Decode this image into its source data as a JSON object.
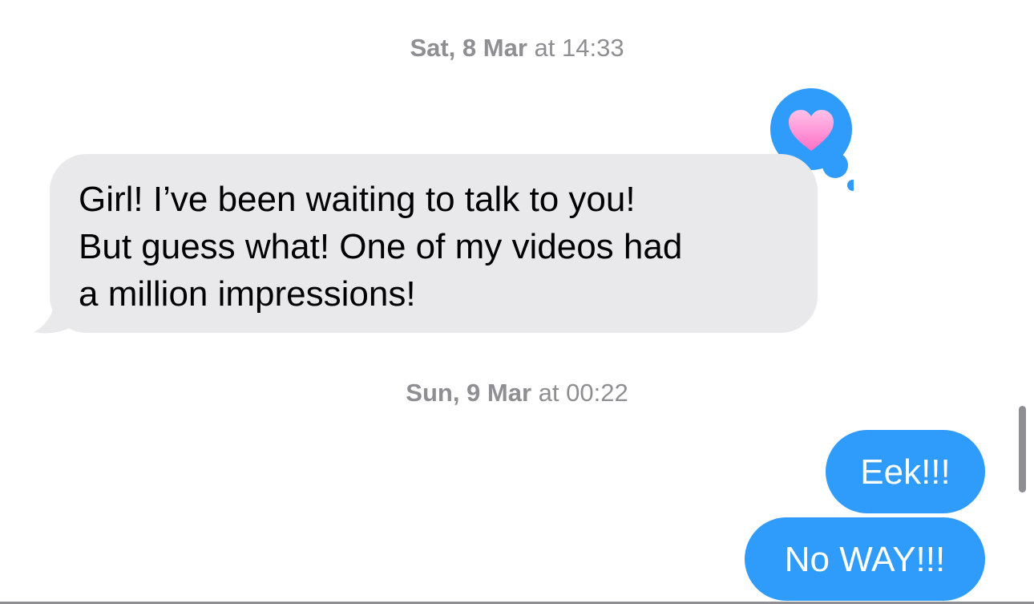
{
  "conversation": {
    "timestamps": [
      {
        "day": "Sat, 8 Mar",
        "time": "at 14:33"
      },
      {
        "day": "Sun, 9 Mar",
        "time": "at 00:22"
      }
    ],
    "incoming": {
      "text": "Girl! I’ve been waiting to talk to you!\nBut guess what! One of my videos had\na million impressions!",
      "reaction_icon": "heart-icon",
      "bubble_color": "#e9e9eb"
    },
    "outgoing": [
      {
        "text": "Eek!!!"
      },
      {
        "text": "No WAY!!!"
      }
    ],
    "outgoing_color": "#2f9bfb"
  }
}
